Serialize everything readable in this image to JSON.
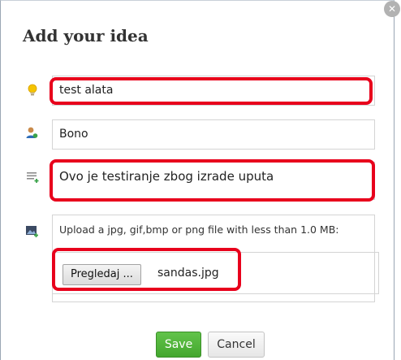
{
  "dialog": {
    "title": "Add your idea",
    "close_icon": "close-icon"
  },
  "form": {
    "idea_title": {
      "value": "test alata",
      "icon": "lightbulb-icon"
    },
    "author": {
      "value": "Bono",
      "icon": "user-icon"
    },
    "description": {
      "value": "Ovo je testiranje zbog izrade uputa",
      "icon": "text-lines-icon"
    },
    "upload": {
      "icon": "image-add-icon",
      "hint": "Upload a jpg, gif,bmp or png file with less than 1.0 MB:",
      "browse_label": "Pregledaj ...",
      "file_name": "sandas.jpg"
    }
  },
  "actions": {
    "save_label": "Save",
    "cancel_label": "Cancel"
  },
  "colors": {
    "highlight": "#e8001c",
    "save_button": "#4fb43a"
  }
}
